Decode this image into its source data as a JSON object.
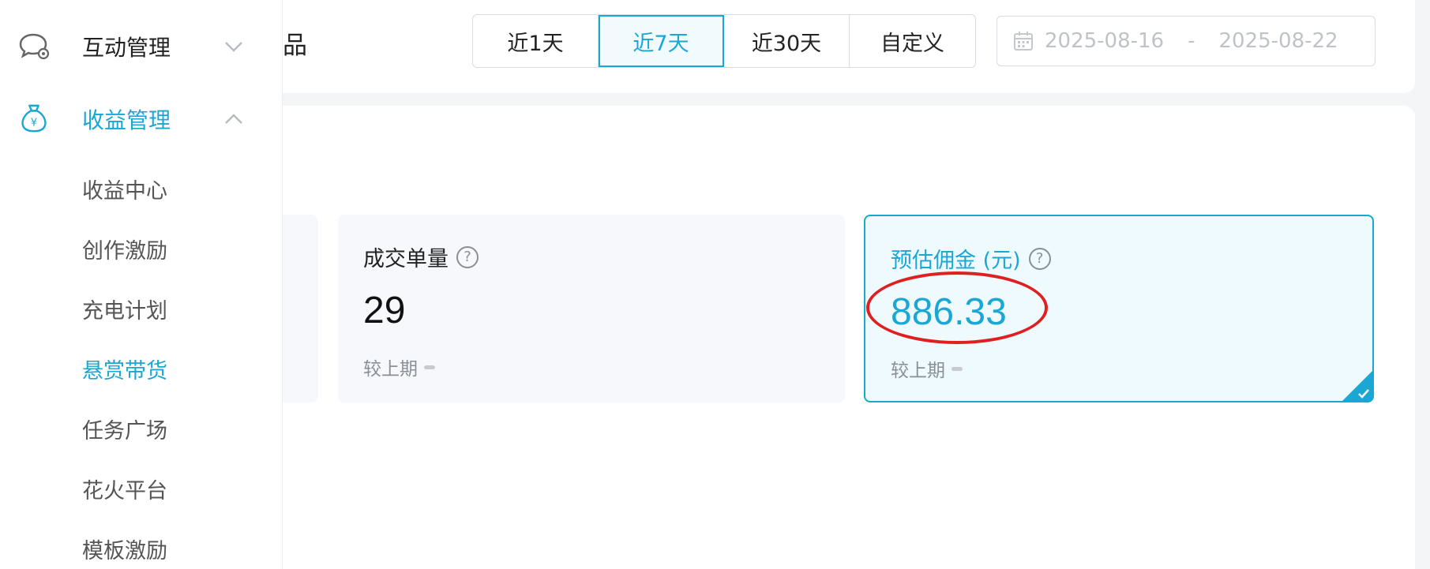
{
  "header": {
    "title_fragment": "品"
  },
  "range_buttons": [
    {
      "label": "近1天",
      "active": false
    },
    {
      "label": "近7天",
      "active": true
    },
    {
      "label": "近30天",
      "active": false
    },
    {
      "label": "自定义",
      "active": false
    }
  ],
  "date_range": {
    "start": "2025-08-16",
    "separator": "-",
    "end": "2025-08-22"
  },
  "metrics": {
    "orders": {
      "label": "成交单量",
      "value": "29",
      "compare_label": "较上期"
    },
    "commission": {
      "label": "预估佣金 (元)",
      "value": "886.33",
      "compare_label": "较上期",
      "selected": true
    }
  },
  "sidebar": {
    "groups": [
      {
        "label": "互动管理",
        "icon": "chat-settings-icon",
        "expanded": false
      },
      {
        "label": "收益管理",
        "icon": "money-bag-icon",
        "expanded": true
      }
    ],
    "sub_items": [
      {
        "label": "收益中心",
        "active": false
      },
      {
        "label": "创作激励",
        "active": false
      },
      {
        "label": "充电计划",
        "active": false
      },
      {
        "label": "悬赏带货",
        "active": true
      },
      {
        "label": "任务广场",
        "active": false
      },
      {
        "label": "花火平台",
        "active": false
      },
      {
        "label": "模板激励",
        "active": false
      }
    ]
  },
  "colors": {
    "accent": "#1aa7d4",
    "annotation": "#e02020"
  }
}
